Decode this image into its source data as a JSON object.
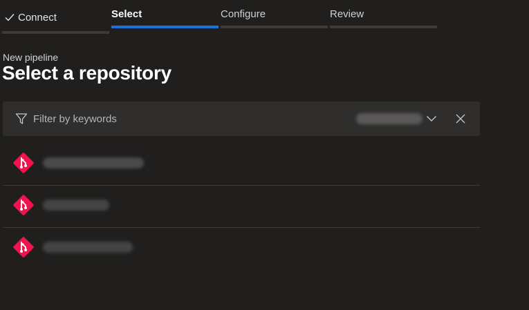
{
  "stepper": {
    "steps": [
      {
        "label": "Connect",
        "state": "completed",
        "icon": "check-icon"
      },
      {
        "label": "Select",
        "state": "active"
      },
      {
        "label": "Configure",
        "state": "pending"
      },
      {
        "label": "Review",
        "state": "pending"
      }
    ]
  },
  "header": {
    "subtitle": "New pipeline",
    "title": "Select a repository"
  },
  "filter": {
    "icon": "filter-icon",
    "placeholder": "Filter by keywords",
    "value": "",
    "dropdown_value": "",
    "dropdown_icon": "chevron-down-icon",
    "clear_icon": "close-icon"
  },
  "repositories": [
    {
      "name": "",
      "icon": "git-repo-icon"
    },
    {
      "name": "",
      "icon": "git-repo-icon"
    },
    {
      "name": "",
      "icon": "git-repo-icon"
    }
  ],
  "colors": {
    "background": "#201f1e",
    "active_step": "#1a73d6",
    "git_icon": "#f0134d",
    "filter_bar": "#2f2e2d"
  }
}
